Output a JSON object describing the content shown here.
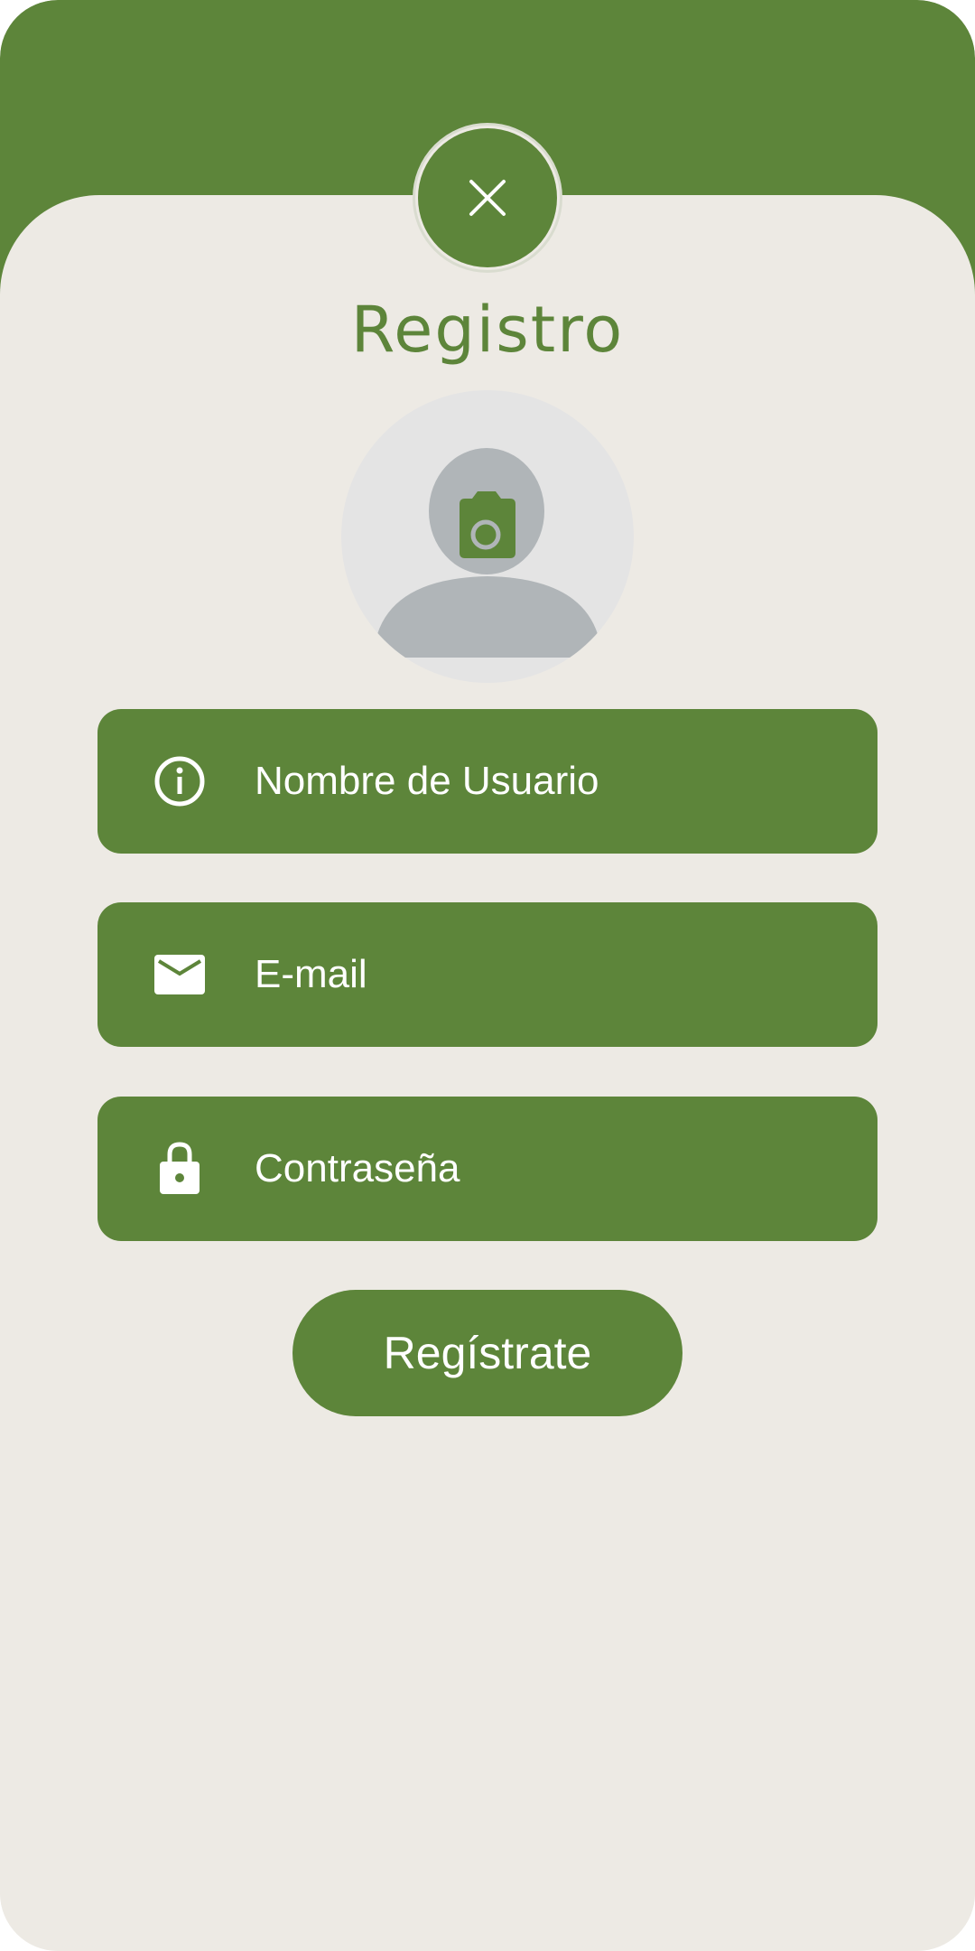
{
  "header": {
    "title": "Registro",
    "close_icon": "close-icon"
  },
  "avatar": {
    "icon": "camera-icon"
  },
  "form": {
    "username_placeholder": "Nombre de Usuario",
    "username_icon": "info-icon",
    "email_placeholder": "E-mail",
    "email_icon": "mail-icon",
    "password_placeholder": "Contraseña",
    "password_icon": "lock-icon",
    "submit_label": "Regístrate"
  },
  "colors": {
    "primary": "#5d853a",
    "background": "#edeae4",
    "avatar_bg": "#e4e4e4",
    "avatar_silhouette": "#b0b5b8",
    "on_primary": "#ffffff"
  }
}
